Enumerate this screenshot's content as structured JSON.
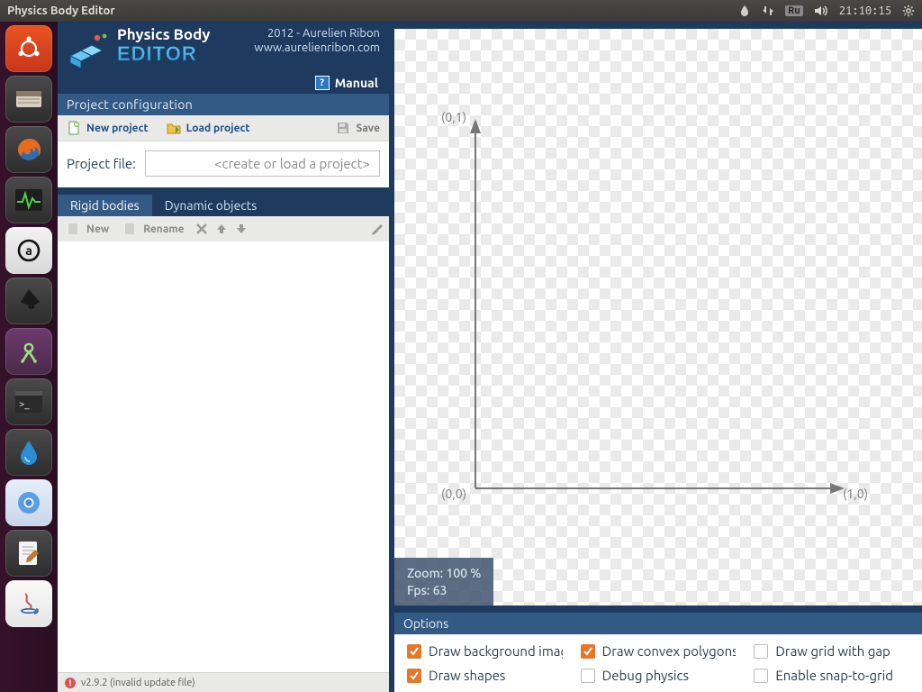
{
  "menubar": {
    "title": "Physics Body Editor",
    "lang": "Ru",
    "clock": "21:10:15"
  },
  "header": {
    "name1": "Physics Body",
    "name2": "EDITOR",
    "credit1": "2012 - Aurelien Ribon",
    "credit2": "www.aurelienribon.com",
    "manual": "Manual"
  },
  "project": {
    "section": "Project configuration",
    "new": "New project",
    "load": "Load project",
    "save": "Save",
    "file_label": "Project file:",
    "file_value": "<create or load a project>"
  },
  "tabs": {
    "rigid": "Rigid bodies",
    "dynamic": "Dynamic objects"
  },
  "bodies": {
    "new": "New",
    "rename": "Rename"
  },
  "status": {
    "text": "v2.9.2 (invalid update file)"
  },
  "canvas": {
    "labels": {
      "origin": "(0,0)",
      "x1": "(1,0)",
      "y1": "(0,1)"
    },
    "zoom": "Zoom: 100 %",
    "fps": "Fps: 63"
  },
  "options": {
    "head": "Options",
    "draw_bg": "Draw background image",
    "draw_poly": "Draw convex polygons",
    "draw_grid": "Draw grid with gap",
    "draw_shapes": "Draw shapes",
    "debug": "Debug physics",
    "snap": "Enable snap-to-grid",
    "checked": {
      "draw_bg": true,
      "draw_poly": true,
      "draw_grid": false,
      "draw_shapes": true,
      "debug": false,
      "snap": false
    }
  }
}
